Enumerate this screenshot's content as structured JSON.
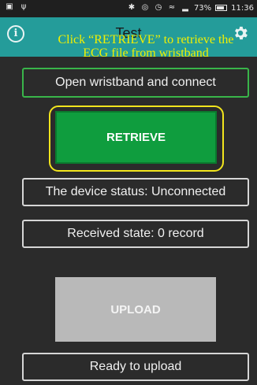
{
  "status_bar": {
    "left_icons": [
      "image-icon",
      "usb-icon"
    ],
    "right_icons": [
      "bluetooth-icon",
      "vibrate-icon",
      "alarm-icon",
      "wifi-icon",
      "signal-icon"
    ],
    "battery_percent": "73%",
    "time": "11:36"
  },
  "app_bar": {
    "title": "Test",
    "info_icon": "info-icon",
    "settings_icon": "gear-icon",
    "color": "#249c9a"
  },
  "annotation": {
    "text": "Click “RETRIEVE” to retrieve the ECG file from wristband",
    "color": "#f2f000"
  },
  "main": {
    "open_connect_label": "Open wristband and connect",
    "retrieve_label": "RETRIEVE",
    "device_status": "The device status: Unconnected",
    "received_state": "Received state: 0 record",
    "upload_label": "UPLOAD",
    "ready_status": "Ready to upload"
  },
  "colors": {
    "background": "#2b2b2b",
    "retrieve_button": "#0f9d3e",
    "upload_button": "#b9b9b9",
    "highlight_frame": "#f2e51d",
    "connect_border": "#39b54a"
  }
}
